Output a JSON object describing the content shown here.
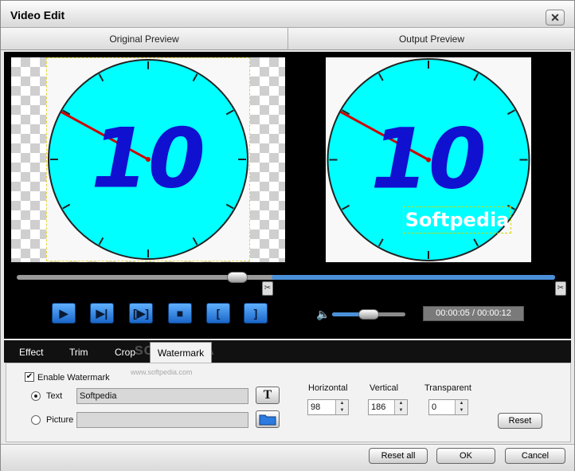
{
  "window": {
    "title": "Video Edit",
    "close_glyph": "✕"
  },
  "preview": {
    "original_label": "Original Preview",
    "output_label": "Output Preview",
    "clock_number": "10",
    "watermark_text": "Softpedia"
  },
  "playback": {
    "time_display": "00:00:05 / 00:00:12",
    "seek_position": 0.41,
    "volume_level": 0.45,
    "buttons": [
      {
        "name": "play-button",
        "icon": "play-icon",
        "glyph": "▶"
      },
      {
        "name": "next-frame-button",
        "icon": "step-forward-icon",
        "glyph": "▶|"
      },
      {
        "name": "frame-button",
        "icon": "frame-step-icon",
        "glyph": "[▶]"
      },
      {
        "name": "stop-button",
        "icon": "stop-icon",
        "glyph": "■"
      },
      {
        "name": "set-start-button",
        "icon": "bracket-left-icon",
        "glyph": "["
      },
      {
        "name": "set-end-button",
        "icon": "bracket-right-icon",
        "glyph": "]"
      }
    ],
    "scissor_glyph": "✂",
    "volume_glyph": "🔈"
  },
  "tabs": [
    {
      "label": "Effect"
    },
    {
      "label": "Trim"
    },
    {
      "label": "Crop"
    },
    {
      "label": "Watermark"
    }
  ],
  "active_tab": "Watermark",
  "branding": {
    "ghost_logo": "SOFTPEDIA",
    "url": "www.softpedia.com"
  },
  "watermark": {
    "enable_label": "Enable Watermark",
    "enable_checked": true,
    "text_option_label": "Text",
    "text_value": "Softpedia",
    "picture_option_label": "Picture",
    "picture_value": "",
    "text_style_glyph": "T",
    "horizontal_label": "Horizontal",
    "horizontal_value": "98",
    "vertical_label": "Vertical",
    "vertical_value": "186",
    "transparent_label": "Transparent",
    "transparent_value": "0",
    "reset_label": "Reset"
  },
  "footer": {
    "reset_all_label": "Reset all",
    "ok_label": "OK",
    "cancel_label": "Cancel"
  },
  "colors": {
    "clock_face": "#00ffff",
    "clock_number": "#1010d0",
    "hand": "#d00000",
    "accent_blue": "#4a90d9"
  }
}
